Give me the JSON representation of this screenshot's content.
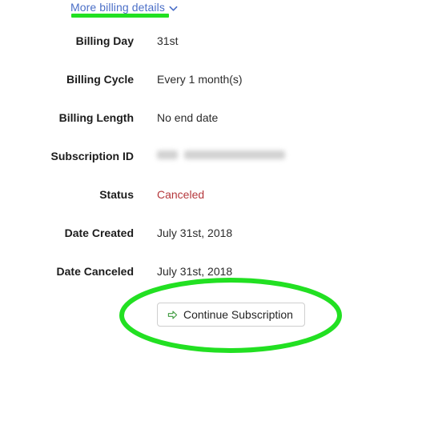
{
  "page": {
    "background_color": "#ffffff",
    "highlight_color": "#22e022",
    "link_color": "#4b6fc7",
    "status_color": "#b5383c"
  },
  "more_details_link": {
    "label": "More billing details",
    "chevron_icon": "chevron-down-icon",
    "highlighted": true
  },
  "billing_details": {
    "rows": [
      {
        "label": "Billing Day",
        "value": "31st",
        "type": "text"
      },
      {
        "label": "Billing Cycle",
        "value": "Every 1 month(s)",
        "type": "text"
      },
      {
        "label": "Billing Length",
        "value": "No end date",
        "type": "text"
      },
      {
        "label": "Subscription ID",
        "value": "",
        "type": "redacted"
      },
      {
        "label": "Status",
        "value": "Canceled",
        "type": "status"
      },
      {
        "label": "Date Created",
        "value": "July 31st, 2018",
        "type": "text"
      },
      {
        "label": "Date Canceled",
        "value": "July 31st, 2018",
        "type": "text"
      }
    ]
  },
  "actions": {
    "continue_subscription": {
      "label": "Continue Subscription",
      "icon": "right-arrow-icon",
      "highlighted": true
    }
  }
}
